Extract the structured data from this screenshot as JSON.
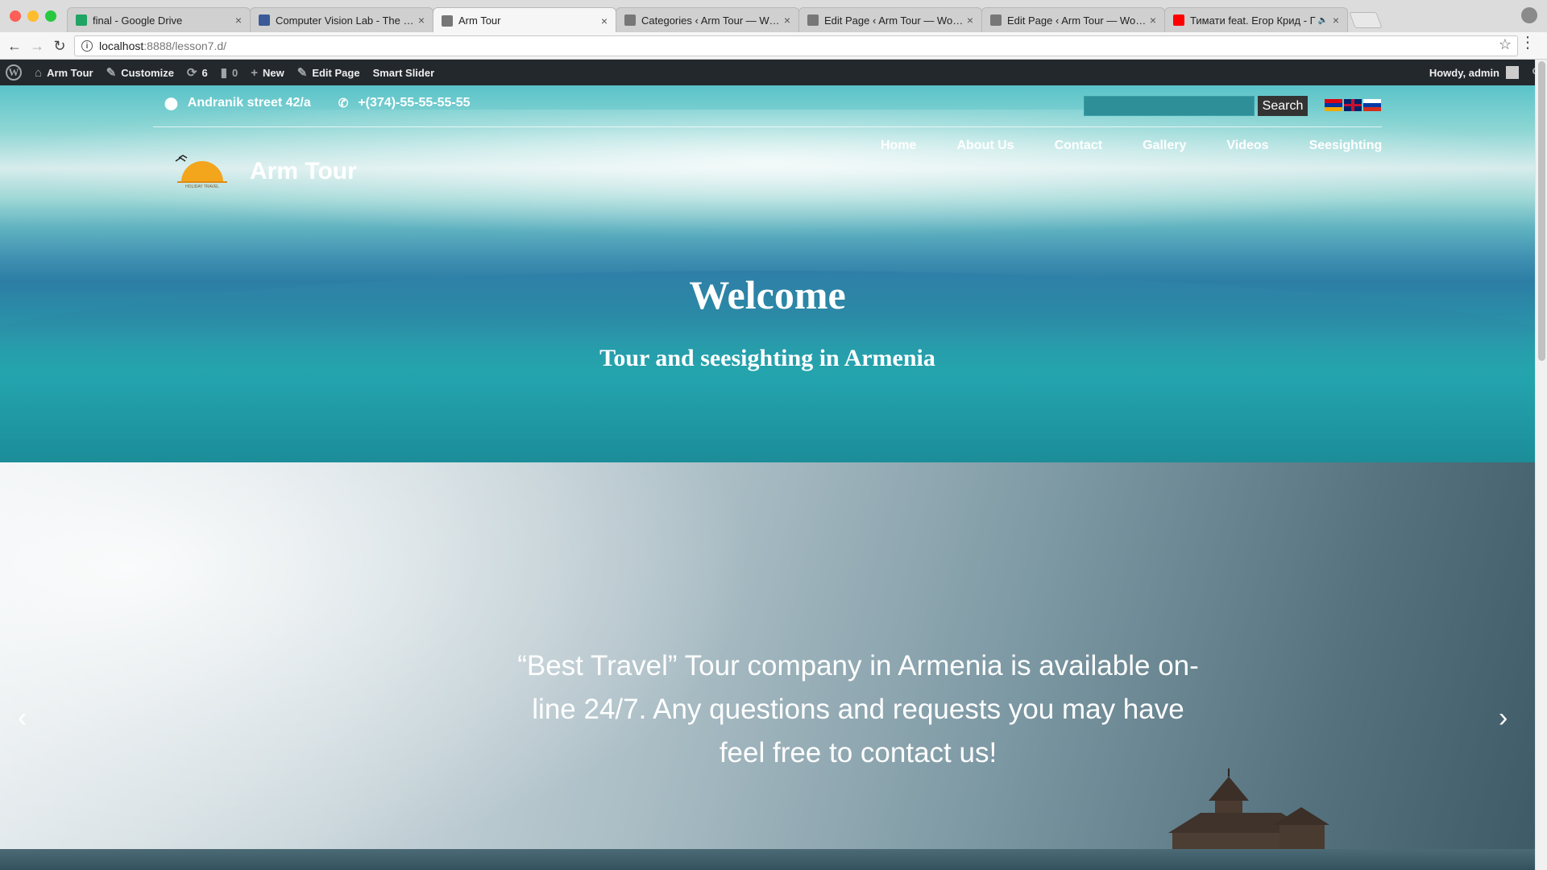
{
  "browser": {
    "tabs": [
      {
        "title": "final - Google Drive",
        "favicon": "google-drive-icon",
        "color": "#1fa463",
        "active": false
      },
      {
        "title": "Computer Vision Lab - The Un",
        "favicon": "facebook-icon",
        "color": "#3b5998",
        "active": false
      },
      {
        "title": "Arm Tour",
        "favicon": "wordpress-icon",
        "color": "#777777",
        "active": true
      },
      {
        "title": "Categories ‹ Arm Tour — Word",
        "favicon": "wordpress-icon",
        "color": "#777777",
        "active": false
      },
      {
        "title": "Edit Page ‹ Arm Tour — WordP",
        "favicon": "wordpress-icon",
        "color": "#777777",
        "active": false
      },
      {
        "title": "Edit Page ‹ Arm Tour — WordP",
        "favicon": "wordpress-icon",
        "color": "#777777",
        "active": false
      },
      {
        "title": "Тимати feat. Егор Крид - Г",
        "favicon": "youtube-icon",
        "color": "#ff0000",
        "active": false,
        "audio": true
      }
    ],
    "url_host": "localhost",
    "url_path": ":8888/lesson7.d/"
  },
  "adminbar": {
    "site": "Arm Tour",
    "customize": "Customize",
    "updates": "6",
    "comments": "0",
    "new": "New",
    "edit_page": "Edit Page",
    "smart_slider": "Smart Slider",
    "howdy": "Howdy, admin"
  },
  "header": {
    "address": "Andranik street 42/a",
    "phone": "+(374)-55-55-55-55",
    "search_button": "Search",
    "search_value": "",
    "logo_text": "HOLIDAY TRAVEL",
    "site_title": "Arm Tour",
    "nav": [
      "Home",
      "About Us",
      "Contact",
      "Gallery",
      "Videos",
      "Seesighting"
    ],
    "flags": [
      "armenia-flag",
      "uk-flag",
      "russia-flag"
    ]
  },
  "hero": {
    "title": "Welcome",
    "subtitle": "Tour and seesighting in Armenia"
  },
  "slider": {
    "quote": "“Best Travel” Tour company in Armenia is available on-line 24/7. Any questions and requests you may have feel free to contact us!"
  },
  "colors": {
    "adminbar_bg": "#23282d",
    "search_button_bg": "#333333",
    "sea_teal": "#27a6ad"
  }
}
